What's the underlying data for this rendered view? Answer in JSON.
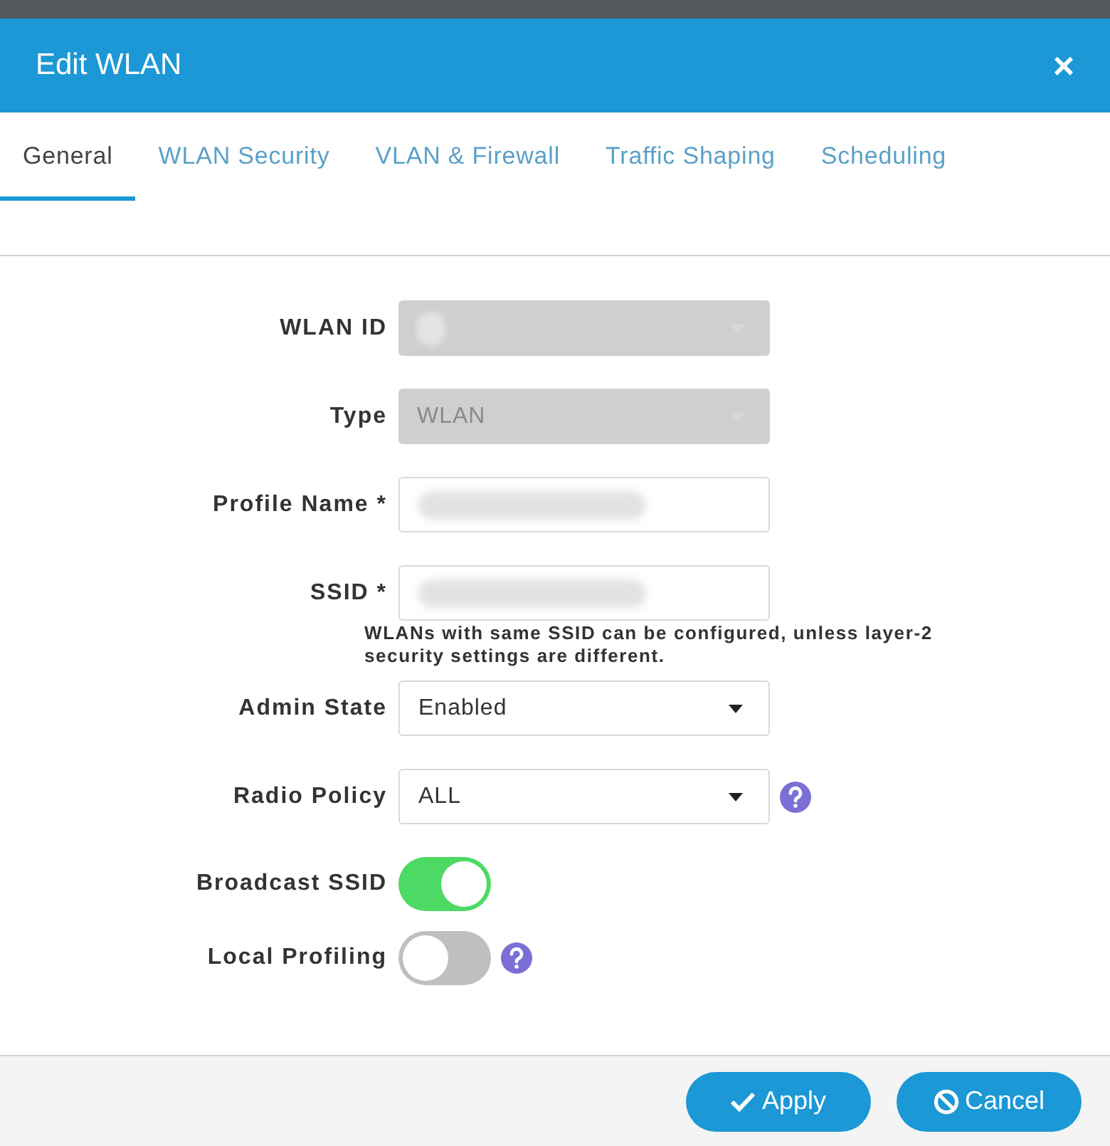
{
  "dialog": {
    "title": "Edit WLAN",
    "close": "×"
  },
  "tabs": [
    {
      "label": "General",
      "selected": true
    },
    {
      "label": "WLAN Security",
      "selected": false
    },
    {
      "label": "VLAN & Firewall",
      "selected": false
    },
    {
      "label": "Traffic Shaping",
      "selected": false
    },
    {
      "label": "Scheduling",
      "selected": false
    }
  ],
  "fields": [
    {
      "kind": "select",
      "label": "WLAN ID",
      "disabled": true,
      "redacted": true
    },
    {
      "kind": "select",
      "label": "Type",
      "disabled": true,
      "value": "WLAN"
    },
    {
      "kind": "input",
      "label": "Profile Name *",
      "disabled": false,
      "redacted": true
    },
    {
      "kind": "input",
      "label": "SSID *",
      "disabled": false,
      "redacted": true,
      "hint": "WLANs with same SSID can be configured, unless layer-2 security settings are different."
    },
    {
      "kind": "select",
      "label": "Admin State",
      "disabled": false,
      "value": "Enabled"
    },
    {
      "kind": "select",
      "label": "Radio Policy",
      "disabled": false,
      "value": "ALL",
      "help": true
    },
    {
      "kind": "toggle",
      "label": "Broadcast SSID",
      "on": true
    },
    {
      "kind": "toggle",
      "label": "Local Profiling",
      "on": false,
      "help": true
    }
  ],
  "buttons": [
    {
      "kind": "apply",
      "label": "Apply"
    },
    {
      "kind": "cancel",
      "label": "Cancel"
    }
  ]
}
